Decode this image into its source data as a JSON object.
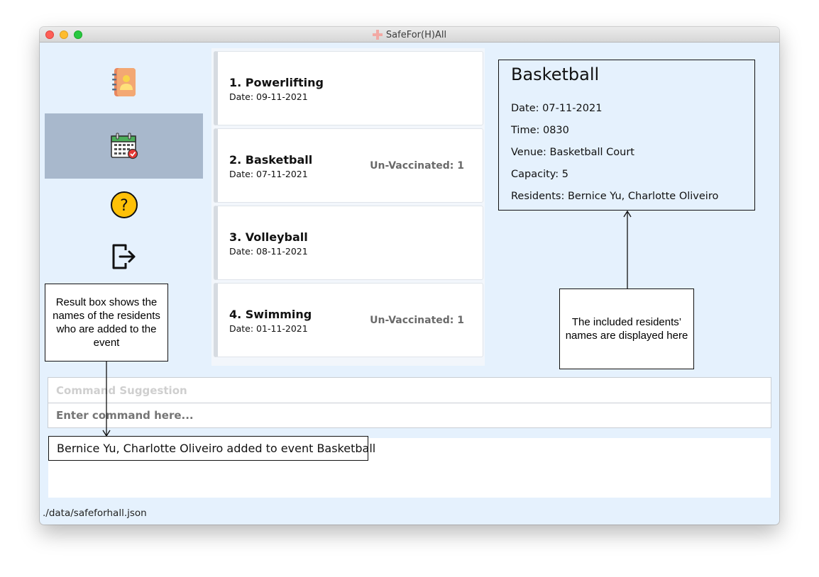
{
  "window": {
    "title": "SafeFor(H)All"
  },
  "sidebar": {
    "items": [
      {
        "name": "residents",
        "icon": "address-book-icon",
        "active": false
      },
      {
        "name": "events",
        "icon": "calendar-icon",
        "active": true
      },
      {
        "name": "help",
        "icon": "help-icon",
        "active": false
      },
      {
        "name": "exit",
        "icon": "exit-icon",
        "active": false
      }
    ]
  },
  "events": [
    {
      "name": "1.  Powerlifting",
      "date": "Date: 09-11-2021",
      "unvaccinated": ""
    },
    {
      "name": "2.  Basketball",
      "date": "Date: 07-11-2021",
      "unvaccinated": "Un-Vaccinated: 1"
    },
    {
      "name": "3.  Volleyball",
      "date": "Date: 08-11-2021",
      "unvaccinated": ""
    },
    {
      "name": "4.  Swimming",
      "date": "Date: 01-11-2021",
      "unvaccinated": "Un-Vaccinated: 1"
    }
  ],
  "detail": {
    "title": "Basketball",
    "date": "Date: 07-11-2021",
    "time": "Time: 0830",
    "venue": "Venue: Basketball Court",
    "capacity": "Capacity: 5",
    "residents": "Residents: Bernice Yu, Charlotte Oliveiro"
  },
  "callouts": {
    "left": "Result box shows the names of the residents who are added to the event",
    "right": "The included residents’ names are displayed here"
  },
  "command": {
    "suggestion": "Command Suggestion",
    "placeholder": "Enter command here..."
  },
  "result": {
    "text": "Bernice Yu, Charlotte Oliveiro added to event Basketball"
  },
  "status": {
    "path": "./data/safeforhall.json"
  }
}
